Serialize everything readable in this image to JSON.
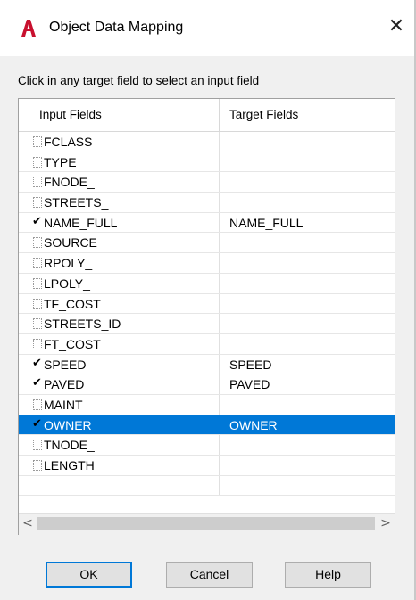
{
  "window": {
    "title": "Object Data Mapping",
    "close_glyph": "✕",
    "app_icon": "autocad-a-icon",
    "accent_color": "#0078d7"
  },
  "instruction": "Click in any target field to select an input field",
  "grid": {
    "headers": {
      "input": "Input Fields",
      "target": "Target Fields"
    },
    "rows": [
      {
        "input": "FCLASS",
        "checked": false,
        "target": ""
      },
      {
        "input": "TYPE",
        "checked": false,
        "target": ""
      },
      {
        "input": "FNODE_",
        "checked": false,
        "target": ""
      },
      {
        "input": "STREETS_",
        "checked": false,
        "target": ""
      },
      {
        "input": "NAME_FULL",
        "checked": true,
        "target": "NAME_FULL"
      },
      {
        "input": "SOURCE",
        "checked": false,
        "target": ""
      },
      {
        "input": "RPOLY_",
        "checked": false,
        "target": ""
      },
      {
        "input": "LPOLY_",
        "checked": false,
        "target": ""
      },
      {
        "input": "TF_COST",
        "checked": false,
        "target": ""
      },
      {
        "input": "STREETS_ID",
        "checked": false,
        "target": ""
      },
      {
        "input": "FT_COST",
        "checked": false,
        "target": ""
      },
      {
        "input": "SPEED",
        "checked": true,
        "target": "SPEED"
      },
      {
        "input": "PAVED",
        "checked": true,
        "target": "PAVED"
      },
      {
        "input": "MAINT",
        "checked": false,
        "target": ""
      },
      {
        "input": "OWNER",
        "checked": true,
        "target": "OWNER",
        "selected": true
      },
      {
        "input": "TNODE_",
        "checked": false,
        "target": ""
      },
      {
        "input": "LENGTH",
        "checked": false,
        "target": ""
      }
    ]
  },
  "scrollbar": {
    "left_glyph": "<",
    "right_glyph": ">"
  },
  "buttons": {
    "ok": "OK",
    "cancel": "Cancel",
    "help": "Help"
  }
}
